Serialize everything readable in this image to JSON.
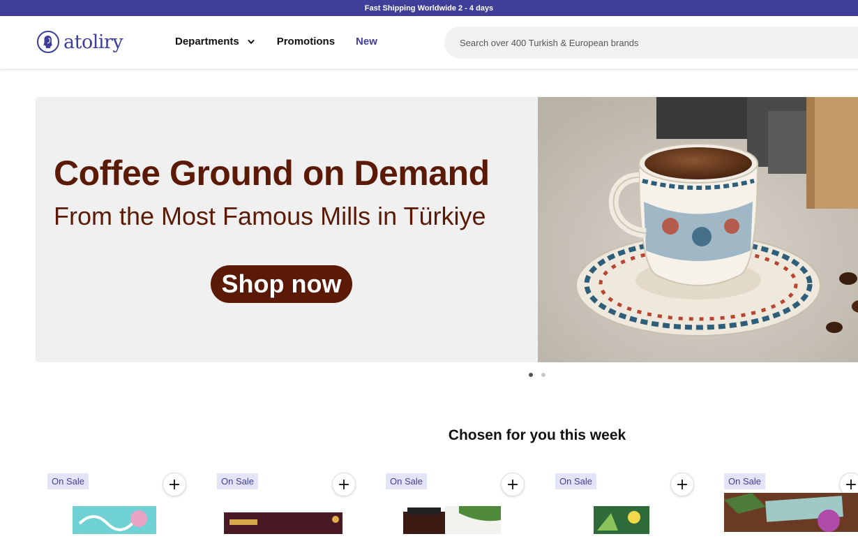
{
  "topbar": {
    "text": "Fast Shipping Worldwide 2 - 4 days"
  },
  "header": {
    "logo_text": "atoliry",
    "nav": [
      {
        "label": "Departments",
        "has_dropdown": true
      },
      {
        "label": "Promotions"
      },
      {
        "label": "New"
      }
    ],
    "search_placeholder": "Search over 400 Turkish & European brands"
  },
  "hero": {
    "title": "Coffee Ground on Demand",
    "subtitle": "From the Most Famous Mills in Türkiye",
    "button_label": "Shop now",
    "slide_count": 2,
    "active_slide": 1
  },
  "section": {
    "title": "Chosen for you this week"
  },
  "products": [
    {
      "badge": "On Sale",
      "add_icon": "plus-icon"
    },
    {
      "badge": "On Sale",
      "add_icon": "plus-icon"
    },
    {
      "badge": "On Sale",
      "add_icon": "plus-icon"
    },
    {
      "badge": "On Sale",
      "add_icon": "plus-icon"
    },
    {
      "badge": "On Sale",
      "add_icon": "plus-icon"
    }
  ],
  "colors": {
    "brand": "#3f3f9a",
    "hero_text": "#5a1a05",
    "badge_bg": "#e3e4f7"
  }
}
